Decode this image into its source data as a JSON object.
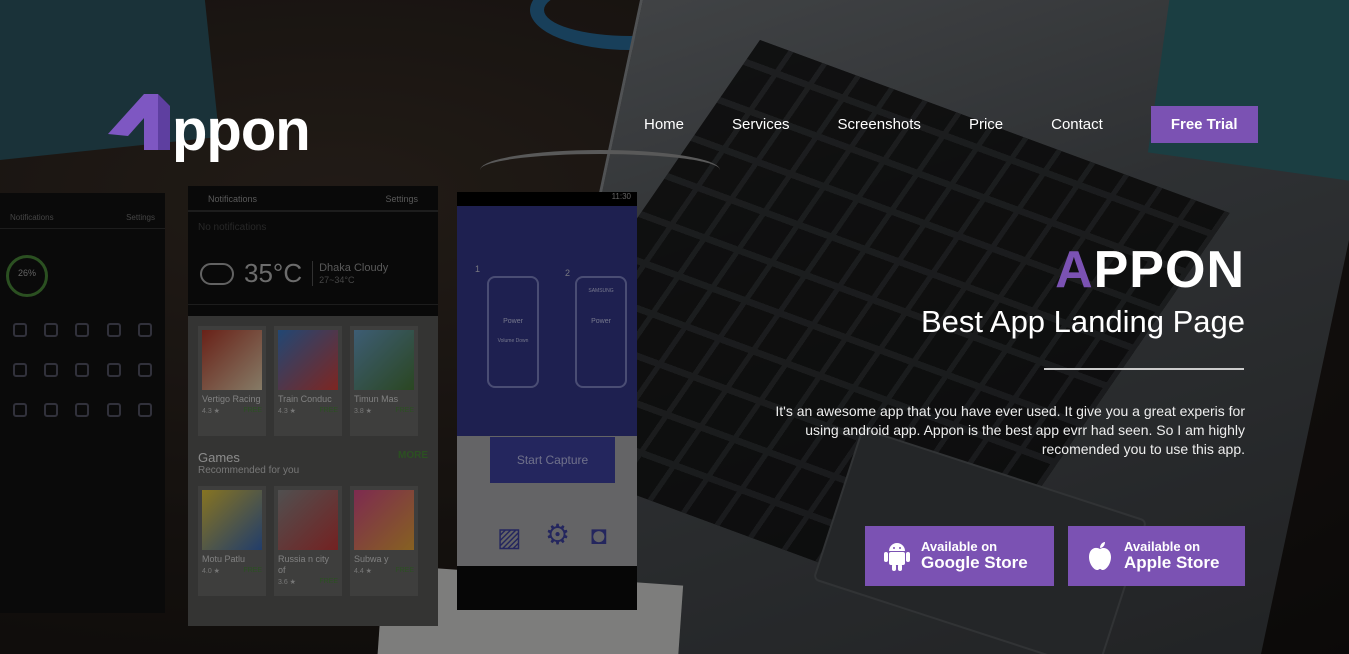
{
  "brand": {
    "logo_text": "Appon",
    "accent": "#7b52b3"
  },
  "nav": {
    "items": [
      "Home",
      "Services",
      "Screenshots",
      "Price",
      "Contact"
    ],
    "cta": "Free Trial"
  },
  "hero": {
    "title_accent": "A",
    "title_rest": "PPON",
    "subtitle": "Best App Landing Page",
    "description": "It's an awesome app that you have ever used. It give you a great experis for using android app. Appon is the best app evrr had seen. So I am highly recomended you to use this app."
  },
  "store_buttons": {
    "google": {
      "line1": "Available on",
      "line2": "Google Store",
      "icon": "android-icon"
    },
    "apple": {
      "line1": "Available on",
      "line2": "Apple Store",
      "icon": "apple-icon"
    }
  },
  "phones": {
    "left": {
      "tabs": [
        "Notifications",
        "Settings"
      ],
      "battery": "26%"
    },
    "middle": {
      "tabs": [
        "Notifications",
        "Settings"
      ],
      "no_notifications": "No notifications",
      "temperature": "35°C",
      "location": "Dhaka Cloudy",
      "range": "27~34°C",
      "row1": [
        {
          "name": "Vertigo Racing",
          "rating": "4.3 ★",
          "price": "FREE"
        },
        {
          "name": "Train Conduc",
          "rating": "4.3 ★",
          "price": "FREE"
        },
        {
          "name": "Timun Mas",
          "rating": "3.8 ★",
          "price": "FREE"
        }
      ],
      "section_title": "Games",
      "section_sub": "Recommended for you",
      "more": "MORE",
      "row2": [
        {
          "name": "Motu Patlu",
          "rating": "4.0 ★",
          "price": "FREE"
        },
        {
          "name": "Russia n city of",
          "rating": "3.6 ★",
          "price": "FREE"
        },
        {
          "name": "Subwa y",
          "rating": "4.4 ★",
          "price": "FREE"
        }
      ]
    },
    "right": {
      "time": "11:30",
      "step1": "1",
      "step2": "2",
      "power": "Power",
      "volume_down": "Volume Down",
      "brand_label": "SAMSUNG",
      "button": "Start Capture"
    }
  }
}
